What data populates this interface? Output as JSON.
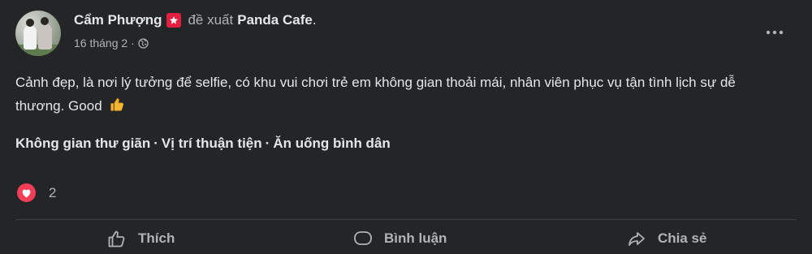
{
  "post": {
    "author": "Cẩm Phượng",
    "recommend_text": "đề xuất",
    "page_name": "Panda Cafe",
    "period": ".",
    "date": "16 tháng 2",
    "separator": "·",
    "privacy_icon": "globe-icon",
    "body_text": "Cảnh đẹp, là nơi lý tưởng để selfie, có khu vui chơi trẻ em không gian thoải mái, nhân viên phục vụ tận tình lịch sự dễ thương. Good",
    "body_emoji": "thumbs-up-emoji",
    "tags": [
      "Không gian thư giãn",
      "Vị trí thuận tiện",
      "Ăn uống bình dân"
    ],
    "tag_separator": "·",
    "reaction_icon": "heart-icon",
    "reaction_count": "2"
  },
  "actions": {
    "like_label": "Thích",
    "comment_label": "Bình luận",
    "share_label": "Chia sẻ"
  },
  "colors": {
    "background": "#242526",
    "primary_text": "#e4e6eb",
    "secondary_text": "#b0b3b8",
    "heart": "#f33e58",
    "badge": "#e41e3f",
    "divider": "#3e4042"
  }
}
